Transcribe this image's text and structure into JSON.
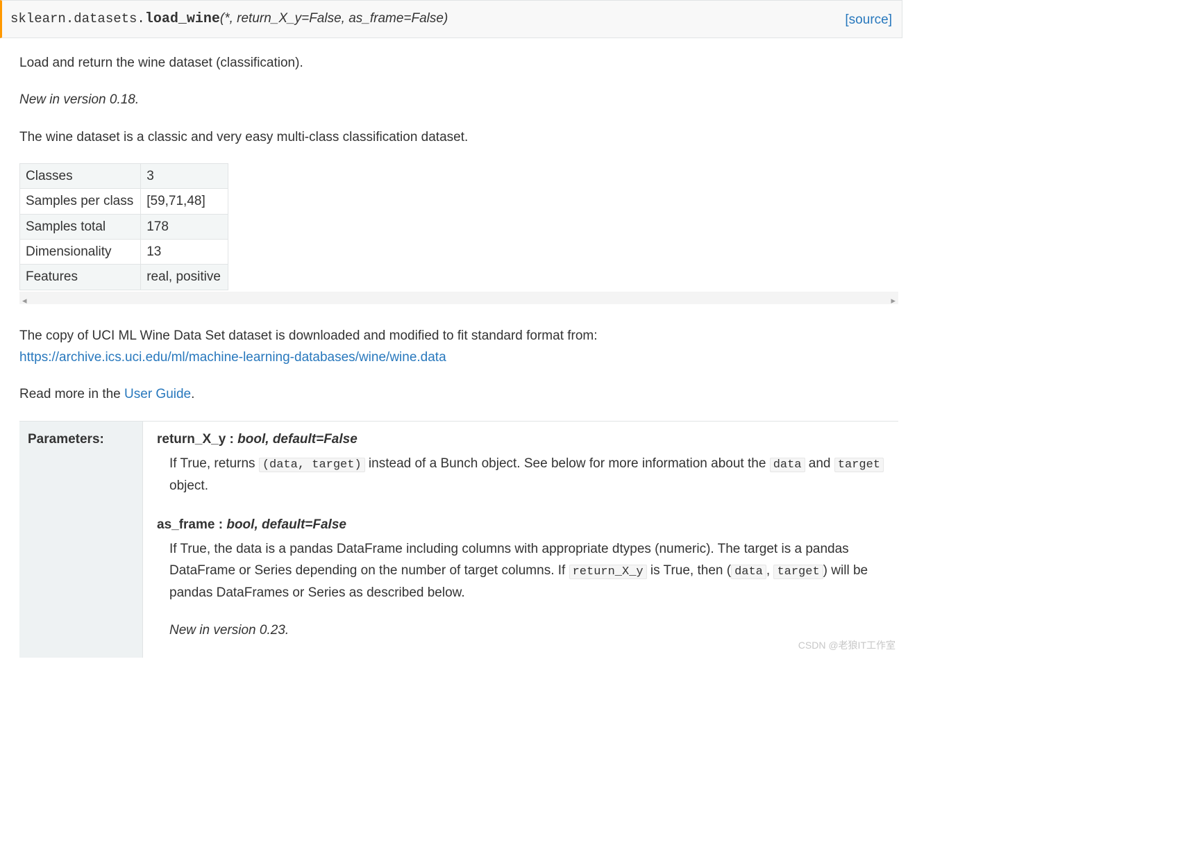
{
  "signature": {
    "module": "sklearn.datasets.",
    "name": "load_wine",
    "params": "(*, return_X_y=False, as_frame=False)",
    "source_label": "[source]"
  },
  "description": {
    "lead": "Load and return the wine dataset (classification).",
    "version_note": "New in version 0.18.",
    "intro": "The wine dataset is a classic and very easy multi-class classification dataset."
  },
  "data_table": [
    {
      "k": "Classes",
      "v": "3"
    },
    {
      "k": "Samples per class",
      "v": "[59,71,48]"
    },
    {
      "k": "Samples total",
      "v": "178"
    },
    {
      "k": "Dimensionality",
      "v": "13"
    },
    {
      "k": "Features",
      "v": "real, positive"
    }
  ],
  "uci": {
    "pre": "The copy of UCI ML Wine Data Set dataset is downloaded and modified to fit standard format from:",
    "url": "https://archive.ics.uci.edu/ml/machine-learning-databases/wine/wine.data"
  },
  "readmore": {
    "pre": "Read more in the ",
    "link": "User Guide",
    "post": "."
  },
  "parameters": {
    "label": "Parameters:",
    "items": [
      {
        "name": "return_X_y",
        "type": "bool, default=False",
        "desc_pre": "If True, returns ",
        "code1": "(data, target)",
        "desc_mid": " instead of a Bunch object. See below for more information about the ",
        "code2": "data",
        "desc_mid2": " and ",
        "code3": "target",
        "desc_post": " object.",
        "version": ""
      },
      {
        "name": "as_frame",
        "type": "bool, default=False",
        "desc_pre": "If True, the data is a pandas DataFrame including columns with appropriate dtypes (numeric). The target is a pandas DataFrame or Series depending on the number of target columns. If ",
        "code1": "return_X_y",
        "desc_mid": " is True, then (",
        "code2": "data",
        "desc_mid2": ", ",
        "code3": "target",
        "desc_post": ") will be pandas DataFrames or Series as described below.",
        "version": "New in version 0.23."
      }
    ]
  },
  "watermark": "CSDN @老狼IT工作室"
}
